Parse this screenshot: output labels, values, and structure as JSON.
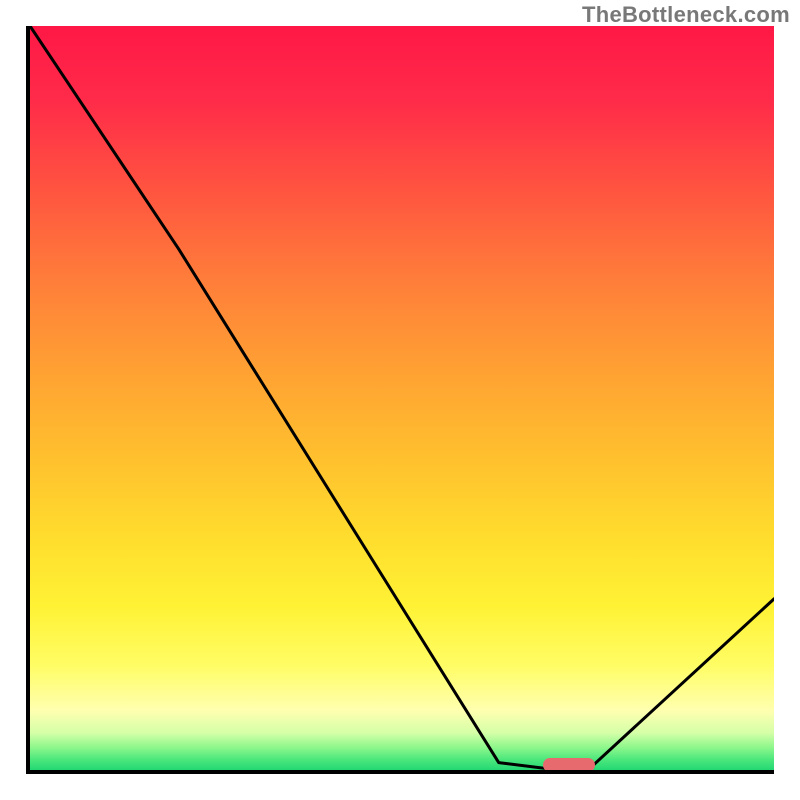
{
  "watermark": "TheBottleneck.com",
  "chart_data": {
    "type": "line",
    "title": "",
    "xlabel": "",
    "ylabel": "",
    "xlim": [
      0,
      100
    ],
    "ylim": [
      0,
      100
    ],
    "grid": false,
    "legend": false,
    "series": [
      {
        "name": "bottleneck-curve",
        "x": [
          0,
          20,
          63,
          71,
          75,
          100
        ],
        "y": [
          100,
          70,
          1,
          0,
          0,
          23
        ]
      }
    ],
    "marker": {
      "name": "optimal-range",
      "x_start": 69,
      "x_end": 76,
      "y": 0,
      "color": "#e76a6f"
    },
    "background_gradient": {
      "top": "#ff1846",
      "mid": "#ffd22e",
      "bottom": "#23d873"
    }
  }
}
